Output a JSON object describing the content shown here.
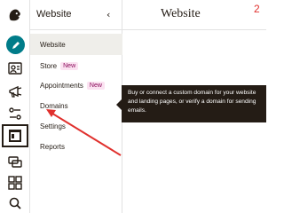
{
  "panel": {
    "title": "Website",
    "items": [
      {
        "label": "Website",
        "badge": ""
      },
      {
        "label": "Store",
        "badge": "New"
      },
      {
        "label": "Appointments",
        "badge": "New"
      },
      {
        "label": "Domains",
        "badge": ""
      },
      {
        "label": "Settings",
        "badge": ""
      },
      {
        "label": "Reports",
        "badge": ""
      }
    ]
  },
  "main": {
    "title": "Website",
    "annotation_number": "2"
  },
  "tooltip": {
    "text": "Buy or connect a custom domain for your website and landing pages, or verify a domain for sending emails."
  },
  "rail": {
    "icons": [
      "mailchimp-logo",
      "create-icon",
      "audience-icon",
      "campaigns-icon",
      "automations-icon",
      "website-icon",
      "integrations-icon",
      "content-icon",
      "search-icon"
    ]
  },
  "colors": {
    "accent": "#007c89",
    "selected_bg": "#efeeea",
    "badge_bg": "#fbe2f1",
    "tooltip_bg": "#241c15",
    "annotation": "#e0302d"
  }
}
